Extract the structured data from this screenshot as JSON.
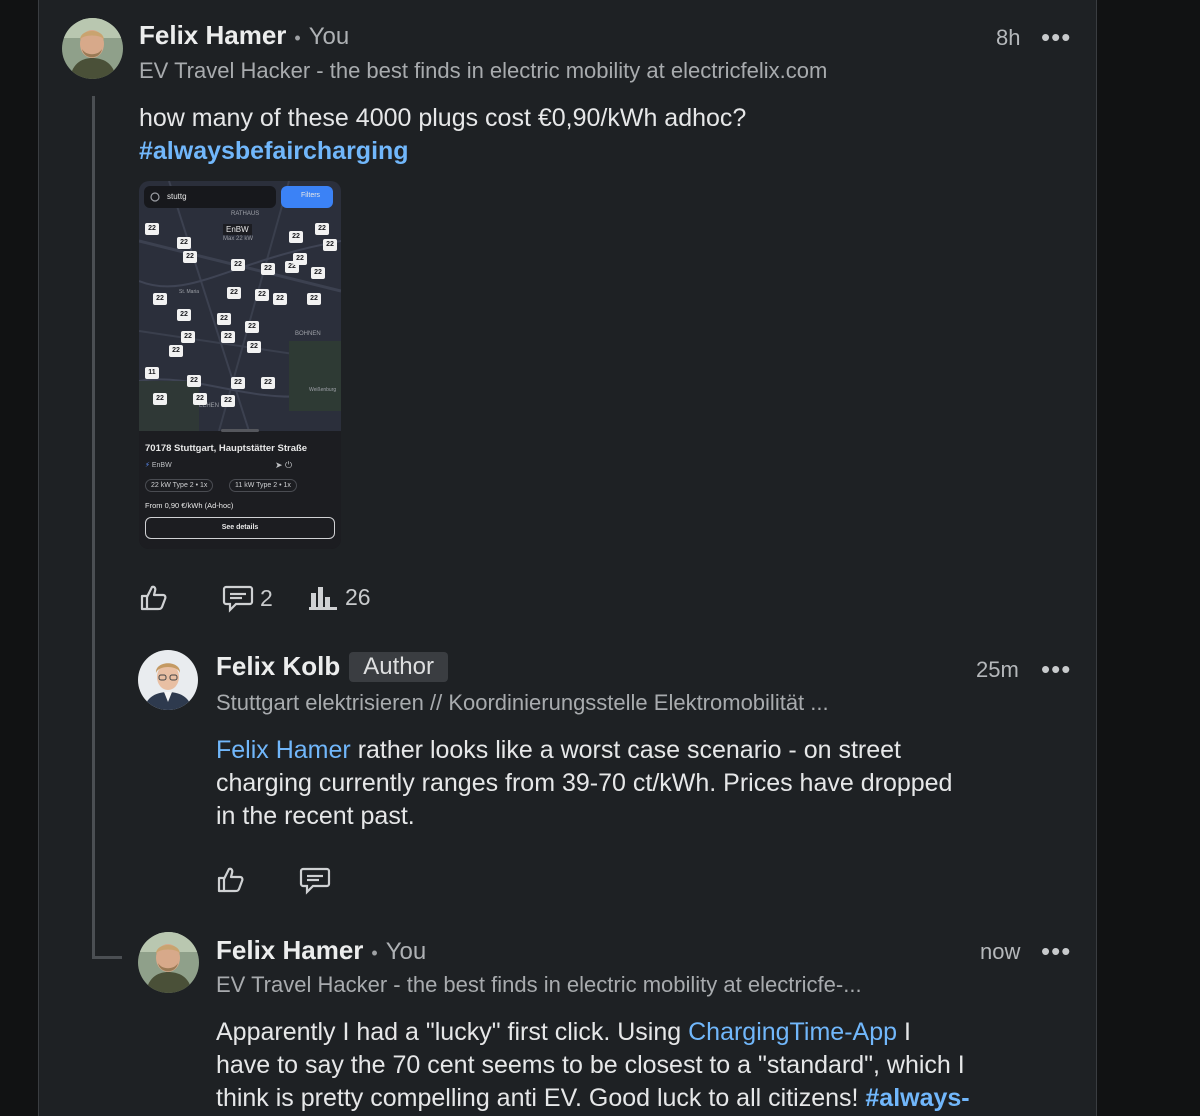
{
  "colors": {
    "background": "#111213",
    "panel": "#1e2124",
    "link": "#71b7fb",
    "text": "#e6e7e8",
    "muted": "#a8abae"
  },
  "post": {
    "author": "Felix Hamer",
    "separator": "•",
    "you_label": "You",
    "headline": "EV Travel Hacker - the best finds in electric mobility at electricfelix.com",
    "time": "8h",
    "more_label": "•••",
    "text": "how many of these 4000 plugs cost €0,90/kWh adhoc?",
    "hashtag": "#alwaysbefaircharging",
    "comments_count": "2",
    "impressions_count": "26",
    "icons": [
      "like-icon",
      "comment-icon",
      "analytics-icon",
      "more-icon"
    ],
    "image": {
      "search_text": "stuttg",
      "filters_label": "Filters",
      "address": "70178 Stuttgart, Hauptstätter Straße",
      "operator": "EnBW",
      "map_popup_operator": "EnBW",
      "map_popup_detail": "Max 22 kW",
      "chip1": "22 kW Type 2 • 1x",
      "chip2": "11 kW Type 2 • 1x",
      "price": "From 0,90 €/kWh (Ad-hoc)",
      "details_button": "See details",
      "map_labels": [
        "RATHAUS",
        "BOHNEN",
        "LEHEN",
        "Weißenburg",
        "St. Maria"
      ],
      "marker_values": [
        "22",
        "22",
        "22",
        "22",
        "22",
        "22",
        "22",
        "22",
        "22",
        "22",
        "22",
        "22",
        "22",
        "22",
        "22",
        "22",
        "22",
        "22",
        "22",
        "22",
        "22",
        "22",
        "22",
        "11",
        "22",
        "22",
        "22",
        "22",
        "22",
        "22"
      ]
    }
  },
  "reply1": {
    "author": "Felix Kolb",
    "badge": "Author",
    "headline": "Stuttgart elektrisieren // Koordinierungsstelle Elektromobilität ...",
    "time": "25m",
    "more_label": "•••",
    "mention": "Felix Hamer",
    "text_line1_rest": " rather looks like a worst case scenario - on street",
    "text_line2": "charging currently ranges from 39-70 ct/kWh. Prices have dropped",
    "text_line3": "in the recent past."
  },
  "reply2": {
    "author": "Felix Hamer",
    "separator": "•",
    "you_label": "You",
    "headline": "EV Travel Hacker - the best finds in electric mobility at electricfe-...",
    "time": "now",
    "more_label": "•••",
    "text_line1_start": "Apparently I had a \"lucky\" first click. Using ",
    "link_text": "ChargingTime-App",
    "text_line1_end": " I",
    "text_line2": "have to say the 70 cent seems to be closest to a \"standard\", which I",
    "text_line3_start": "think is pretty compelling anti EV. Good luck to all citizens! ",
    "hashtag_partial": "#always-"
  }
}
